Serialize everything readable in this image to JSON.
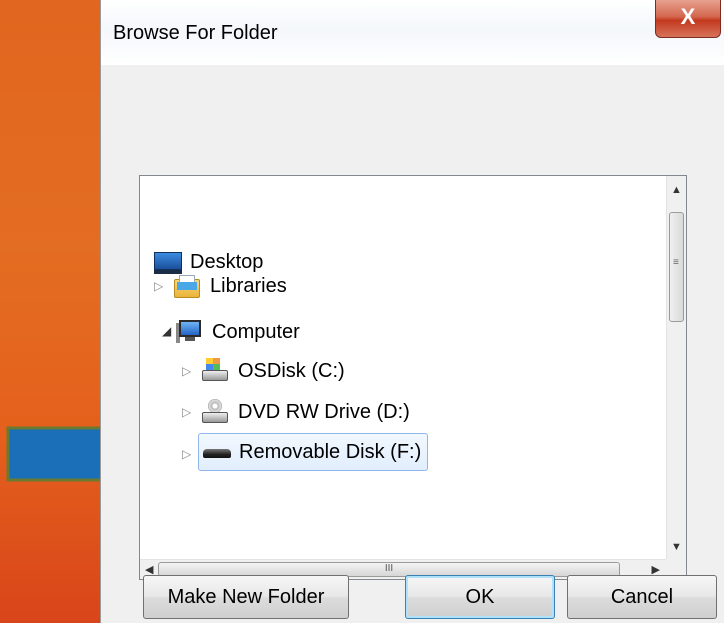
{
  "window": {
    "title": "Browse For Folder",
    "close_label": "X"
  },
  "tree": {
    "items": [
      {
        "label": "Desktop",
        "icon": "desktop-icon",
        "expander": ""
      },
      {
        "label": "Libraries",
        "icon": "libraries-icon",
        "expander": "▷"
      },
      {
        "label": "Computer",
        "icon": "computer-icon",
        "expander": "◢"
      },
      {
        "label": "OSDisk (C:)",
        "icon": "hard-disk-icon",
        "expander": "▷"
      },
      {
        "label": "DVD RW Drive (D:)",
        "icon": "dvd-drive-icon",
        "expander": "▷"
      },
      {
        "label": "Removable Disk (F:)",
        "icon": "removable-disk-icon",
        "expander": "▷",
        "selected": true
      }
    ],
    "scroll_up": "▲",
    "scroll_down": "▼",
    "scroll_left": "◀",
    "scroll_right": "▶",
    "vgrip": "≡",
    "hgrip": "III"
  },
  "buttons": {
    "make_new_folder": "Make New Folder",
    "ok": "OK",
    "cancel": "Cancel"
  },
  "colors": {
    "background": "#e1661f",
    "arrow_fill": "#1a6fb8",
    "arrow_stroke": "#6a7a2e",
    "selection": "#e1eefd"
  }
}
